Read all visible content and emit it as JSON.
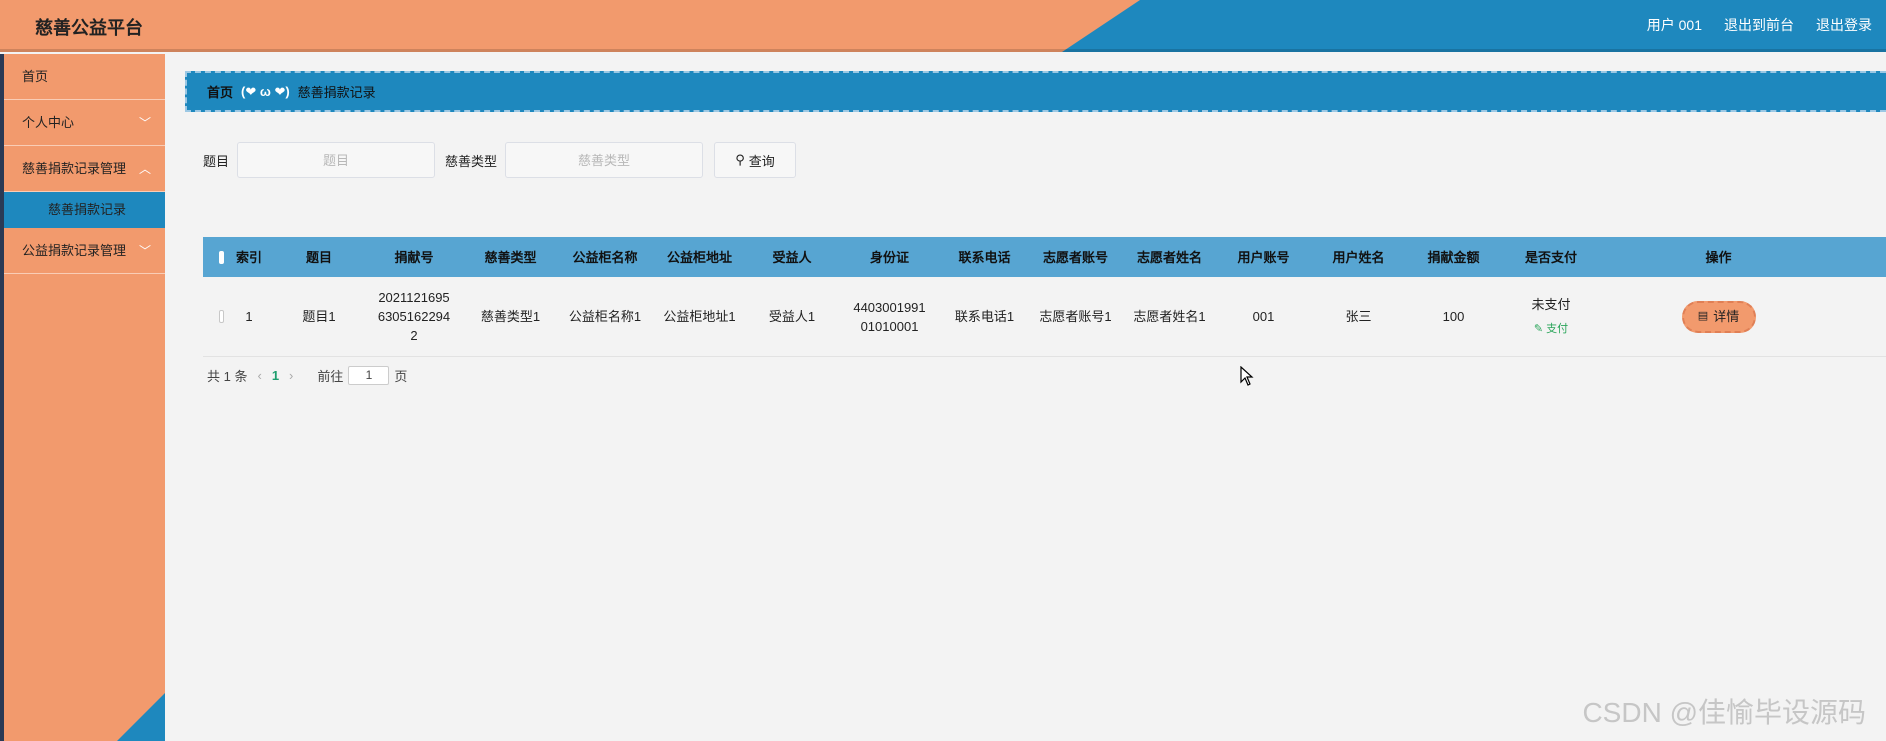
{
  "header": {
    "title": "慈善公益平台",
    "user_label": "用户 001",
    "back_label": "退出到前台",
    "logout_label": "退出登录"
  },
  "sidebar": {
    "items": [
      {
        "label": "首页"
      },
      {
        "label": "个人中心"
      },
      {
        "label": "慈善捐款记录管理"
      },
      {
        "label": "慈善捐款记录"
      },
      {
        "label": "公益捐款记录管理"
      }
    ]
  },
  "breadcrumb": {
    "home": "首页",
    "face": "(❤ ω ❤)",
    "current": "慈善捐款记录"
  },
  "search": {
    "title_label": "题目",
    "title_placeholder": "题目",
    "type_label": "慈善类型",
    "type_placeholder": "慈善类型",
    "query_label": "查询"
  },
  "table": {
    "headers": [
      "索引",
      "题目",
      "捐献号",
      "慈善类型",
      "公益柜名称",
      "公益柜地址",
      "受益人",
      "身份证",
      "联系电话",
      "志愿者账号",
      "志愿者姓名",
      "用户账号",
      "用户姓名",
      "捐献金额",
      "是否支付",
      "操作"
    ],
    "rows": [
      {
        "index": "1",
        "title": "题目1",
        "donation_no": "20211216956305162294 2",
        "donation_no_lines": [
          "2021121695",
          "6305162294",
          "2"
        ],
        "type": "慈善类型1",
        "cabinet_name": "公益柜名称1",
        "cabinet_addr": "公益柜地址1",
        "beneficiary": "受益人1",
        "id_card_lines": [
          "4403001991",
          "01010001"
        ],
        "phone": "联系电话1",
        "volunteer_account": "志愿者账号1",
        "volunteer_name": "志愿者姓名1",
        "user_account": "001",
        "user_name": "张三",
        "amount": "100",
        "paid": "未支付",
        "pay_label": "支付",
        "detail_label": "详情"
      }
    ]
  },
  "pager": {
    "total": "共 1 条",
    "current_page": "1",
    "goto_label": "前往",
    "goto_value": "1",
    "page_unit": "页"
  },
  "watermark": "CSDN @佳愉毕设源码",
  "colors": {
    "orange": "#f29a6d",
    "blue": "#1e88be",
    "table_header": "#57a5d2"
  }
}
